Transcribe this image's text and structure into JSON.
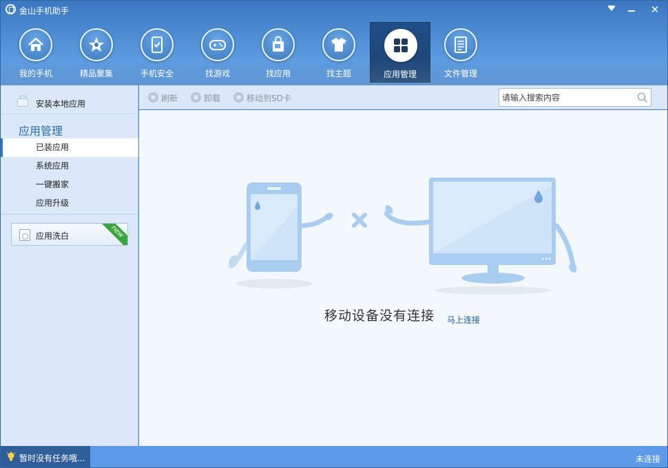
{
  "app": {
    "title": "金山手机助手"
  },
  "window_controls": {
    "menu": "menu",
    "minimize": "minimize",
    "close": "close"
  },
  "nav": {
    "active_index": 6,
    "items": [
      {
        "label": "我的手机",
        "icon": "home-icon"
      },
      {
        "label": "精品聚集",
        "icon": "star-icon"
      },
      {
        "label": "手机安全",
        "icon": "phone-shield-icon"
      },
      {
        "label": "找游戏",
        "icon": "gamepad-icon"
      },
      {
        "label": "找应用",
        "icon": "shopping-bag-icon"
      },
      {
        "label": "找主题",
        "icon": "tshirt-icon"
      },
      {
        "label": "应用管理",
        "icon": "app-grid-icon"
      },
      {
        "label": "文件管理",
        "icon": "document-icon"
      }
    ]
  },
  "sidebar": {
    "install_local": "安装本地应用",
    "heading": "应用管理",
    "items": [
      {
        "label": "已装应用",
        "active": true
      },
      {
        "label": "系统应用",
        "active": false
      },
      {
        "label": "一键搬家",
        "active": false
      },
      {
        "label": "应用升级",
        "active": false
      }
    ],
    "app_wash": {
      "label": "应用洗白",
      "badge": "new"
    }
  },
  "toolbar": {
    "refresh": "刷新",
    "uninstall": "卸载",
    "move_to_sd": "移动到SD卡",
    "search_placeholder": "请输入搜索内容"
  },
  "main": {
    "message": "移动设备没有连接",
    "connect_link": "马上连接"
  },
  "status": {
    "task": "暂时没有任务哦...",
    "connection": "未连接"
  },
  "colors": {
    "header_blue": "#4f8fd4",
    "active_nav": "#1a4272",
    "sidebar_bg": "#dbe8f7",
    "link_blue": "#1e5ea8",
    "status_bar": "#5b9ae6",
    "illustration_blue": "#a8cdf0"
  }
}
